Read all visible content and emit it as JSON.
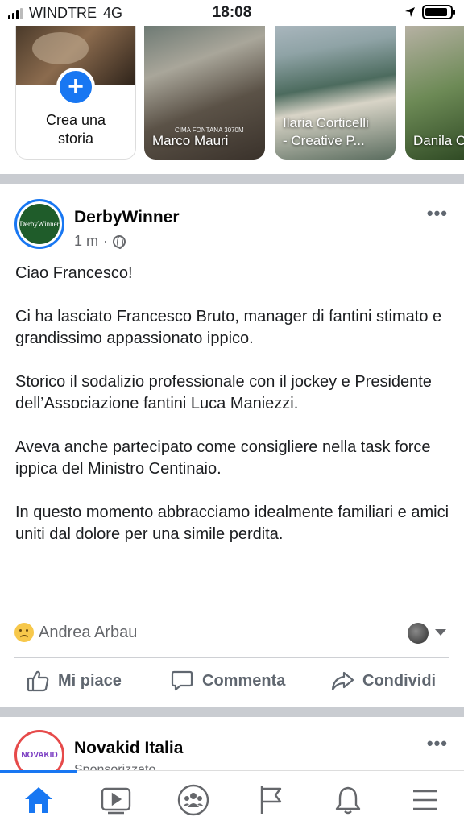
{
  "status_bar": {
    "carrier": "WINDTRE",
    "network": "4G",
    "time": "18:08",
    "battery_level": 0.9
  },
  "stories": {
    "create_label": "Crea una storia",
    "items": [
      {
        "name": "Marco Mauri",
        "watermark": "CIMA FONTANA 3070M"
      },
      {
        "name": "Ilaria Corticelli\n- Creative P..."
      },
      {
        "name": "Danila C"
      }
    ]
  },
  "post": {
    "author": "DerbyWinner",
    "avatar_text": "DerbyWinner",
    "time": "1 m",
    "paragraphs": [
      "Ciao Francesco!",
      "Ci ha lasciato Francesco Bruto, manager di fantini stimato e grandissimo appassionato ippico.",
      "Storico il sodalizio professionale con il jockey e Presidente dell’Associazione fantini Luca Maniezzi.",
      "Aveva anche partecipato come consigliere nella task force ippica del Ministro Centinaio.",
      "In questo momento abbracciamo idealmente familiari e amici uniti dal dolore per una simile perdita."
    ],
    "reaction_user": "Andrea Arbau",
    "actions": {
      "like": "Mi piace",
      "comment": "Commenta",
      "share": "Condividi"
    }
  },
  "next_post": {
    "author": "Novakid Italia",
    "avatar_text": "NOVAKID",
    "subtitle": "Sponsorizzato"
  },
  "tabbar": {
    "tabs": [
      "home-tab",
      "watch-tab",
      "groups-tab",
      "pages-tab",
      "notifications-tab",
      "menu-tab"
    ],
    "active": 0,
    "accent": "#1877f2",
    "inactive": "#65676b"
  }
}
